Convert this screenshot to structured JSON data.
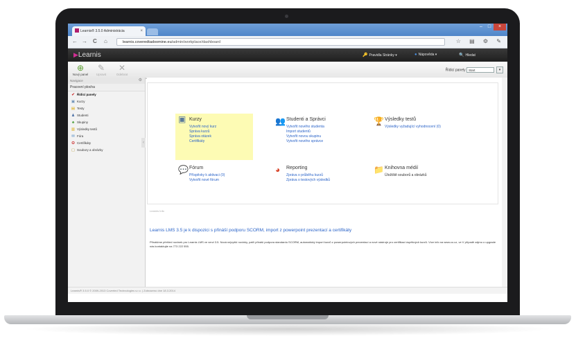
{
  "browser": {
    "tab_title": "Learnis® 3.5.0 Administrácia",
    "tab_close": "×",
    "url_host": "learnis.coveredtadoomine.eu",
    "url_path": "/admin/workplace/dashboard",
    "window_buttons": [
      "–",
      "□",
      "×"
    ],
    "nav": {
      "back": "←",
      "forward": "→",
      "reload": "C",
      "home": "⌂"
    },
    "tools": "☆ ▤ ⚙ ✎"
  },
  "app": {
    "logo": "Learnis",
    "header_items": [
      {
        "icon": "key-icon",
        "glyph": "🔑",
        "label": "Pravidla Stránky ▾"
      },
      {
        "icon": "help-icon",
        "glyph": "●",
        "label": "Nápověda ▾"
      },
      {
        "icon": "search-icon",
        "glyph": "🔍",
        "label": "Hledat"
      }
    ]
  },
  "toolbar": {
    "buttons": [
      {
        "label": "Nový panel",
        "icon": "add-panel-icon",
        "glyph": "⊕",
        "disabled": false
      },
      {
        "label": "Upravit",
        "icon": "edit-chart-icon",
        "glyph": "✎",
        "disabled": true
      },
      {
        "label": "Odebrat",
        "icon": "delete-icon",
        "glyph": "✕",
        "disabled": true
      }
    ],
    "dashboard_label": "Řídicí panely",
    "dashboard_value": "Start",
    "dashboard_dropdown": "▾"
  },
  "sidebar": {
    "title": "Navigace",
    "section": "Pracovní plocha",
    "items": [
      {
        "label": "Řídicí panely",
        "icon": "pin-icon",
        "glyph": "✔",
        "active": true
      },
      {
        "label": "Kurzy",
        "icon": "courses-icon",
        "glyph": "▣",
        "active": false
      },
      {
        "label": "Testy",
        "icon": "tests-icon",
        "glyph": "▤",
        "active": false
      },
      {
        "label": "Studenti",
        "icon": "students-icon",
        "glyph": "♟",
        "active": false
      },
      {
        "label": "Skupiny",
        "icon": "groups-icon",
        "glyph": "♣",
        "active": false
      },
      {
        "label": "Výsledky testů",
        "icon": "results-icon",
        "glyph": "▥",
        "active": false
      },
      {
        "label": "Fóra",
        "icon": "forum-icon",
        "glyph": "✉",
        "active": false
      },
      {
        "label": "Certifikáty",
        "icon": "certificate-icon",
        "glyph": "✪",
        "active": false
      },
      {
        "label": "Soubory a obrázky",
        "icon": "files-icon",
        "glyph": "▢",
        "active": false
      }
    ]
  },
  "dashboard": {
    "tiles": [
      {
        "title": "Kurzy",
        "icon": "courses-tile-icon",
        "glyph": "▣",
        "links": [
          "Vytvořit nový kurz",
          "Správa kurzů",
          "Správa otázek",
          "Certifikáty"
        ],
        "text": []
      },
      {
        "title": "Studenti a Správci",
        "icon": "students-tile-icon",
        "glyph": "👥",
        "links": [
          "Vytvořit nového studenta",
          "Import studentů",
          "Vytvořit novou skupinu",
          "Vytvořit nového správce"
        ],
        "text": []
      },
      {
        "title": "Výsledky testů",
        "icon": "results-tile-icon",
        "glyph": "🏆",
        "links": [
          "Výsledky vyžadující vyhodnocení (0)"
        ],
        "text": []
      },
      {
        "title": "Fórum",
        "icon": "forum-tile-icon",
        "glyph": "💬",
        "links": [
          "Příspěvky k aktivaci (0)",
          "Vytvořit nové fórum"
        ],
        "text": []
      },
      {
        "title": "Reporting",
        "icon": "reporting-tile-icon",
        "glyph": "◕",
        "links": [
          "Zpráva o průběhu kurzů",
          "Zpráva o testových výsledků"
        ],
        "text": []
      },
      {
        "title": "Knihovna médií",
        "icon": "media-library-icon",
        "glyph": "📁",
        "links": [],
        "text": [
          "Úložiště souborů a obrázků"
        ]
      }
    ]
  },
  "news": {
    "label": "Learnis Info",
    "headline": "Learnis LMS 3.5 je k dispozici s přináší podporu SCORM, import z powerpoint prezentací a certifikáty",
    "body": "Přinášíme přehled novinek pro Learnis LMS ve verzi 3.5. Nová nejvyšší novinky, patří přináší podpora standardu SCORM, automatický import kurzů z powerpointových prezentací a nové nástroje pro certifikaci úspěšných kurzů. Více info na www.co.cz, ve V případě zájmu o upgrade nás kontaktujte na 773 222 555."
  },
  "footer": {
    "text": "Learnis® 3.5.0 © 2009-2013 Coverted Technologies s.r.o. | Zobrazeno dne 18.3.2014"
  }
}
